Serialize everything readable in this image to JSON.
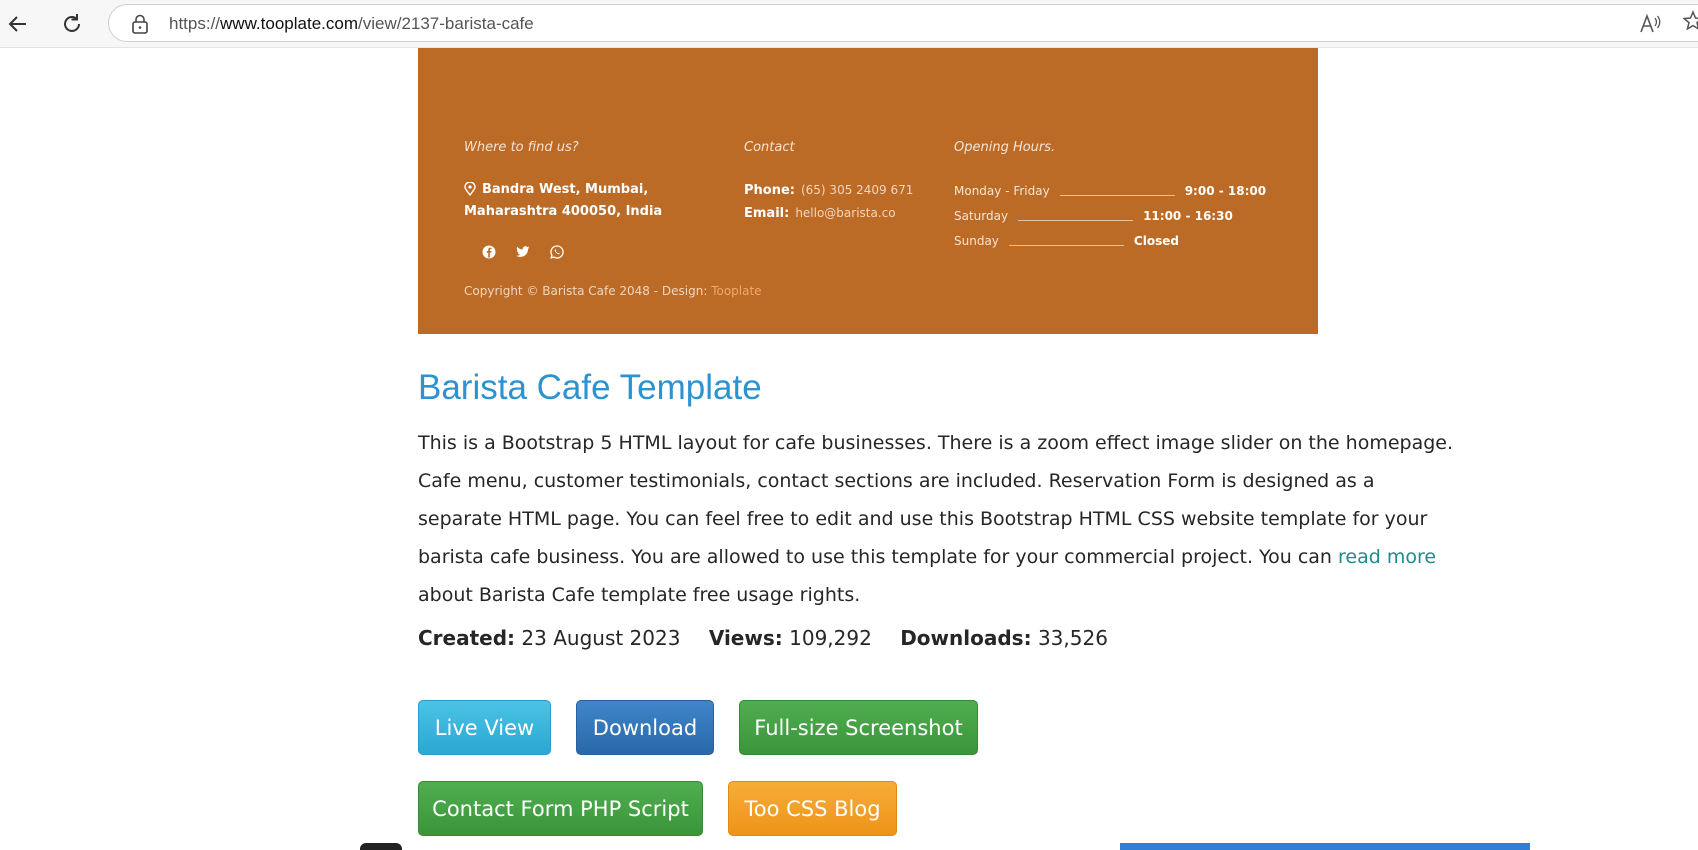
{
  "browser": {
    "url_prefix": "https://",
    "url_host": "www.tooplate.com",
    "url_path": "/view/2137-barista-cafe"
  },
  "preview": {
    "find_heading": "Where to find us?",
    "address": "Bandra West, Mumbai, Maharashtra 400050, India",
    "contact_heading": "Contact",
    "phone_label": "Phone:",
    "phone_value": "(65) 305 2409 671",
    "email_label": "Email:",
    "email_value": "hello@barista.co",
    "hours_heading": "Opening Hours.",
    "hours": [
      {
        "day": "Monday - Friday",
        "time": "9:00 - 18:00"
      },
      {
        "day": "Saturday",
        "time": "11:00 - 16:30"
      },
      {
        "day": "Sunday",
        "time": "Closed"
      }
    ],
    "copyright_text": "Copyright © Barista Cafe 2048 - Design: ",
    "copyright_link": "Tooplate",
    "social_icons": [
      "facebook-icon",
      "twitter-icon",
      "whatsapp-icon"
    ]
  },
  "template": {
    "title": "Barista Cafe Template",
    "desc_before": "This is a Bootstrap 5 HTML layout for cafe businesses. There is a zoom effect image slider on the homepage. Cafe menu, customer testimonials, contact sections are included. Reservation Form is designed as a separate HTML page. You can feel free to edit and use this Bootstrap HTML CSS website template for your barista cafe business. You are allowed to use this template for your commercial project. You can ",
    "desc_link": "read more",
    "desc_after": " about Barista Cafe template free usage rights.",
    "created_label": "Created:",
    "created_value": "23 August 2023",
    "views_label": "Views:",
    "views_value": "109,292",
    "downloads_label": "Downloads:",
    "downloads_value": "33,526"
  },
  "buttons": {
    "live_view": "Live View",
    "download": "Download",
    "full_screenshot": "Full-size Screenshot",
    "contact_php": "Contact Form PHP Script",
    "css_blog": "Too CSS Blog"
  },
  "colors": {
    "preview_bg": "#bc6b27",
    "title": "#2b93d1",
    "link": "#1e8b8c",
    "live_view": "#2aa7d3",
    "download": "#2a68a9",
    "green": "#3a953a",
    "orange": "#ee9418"
  }
}
